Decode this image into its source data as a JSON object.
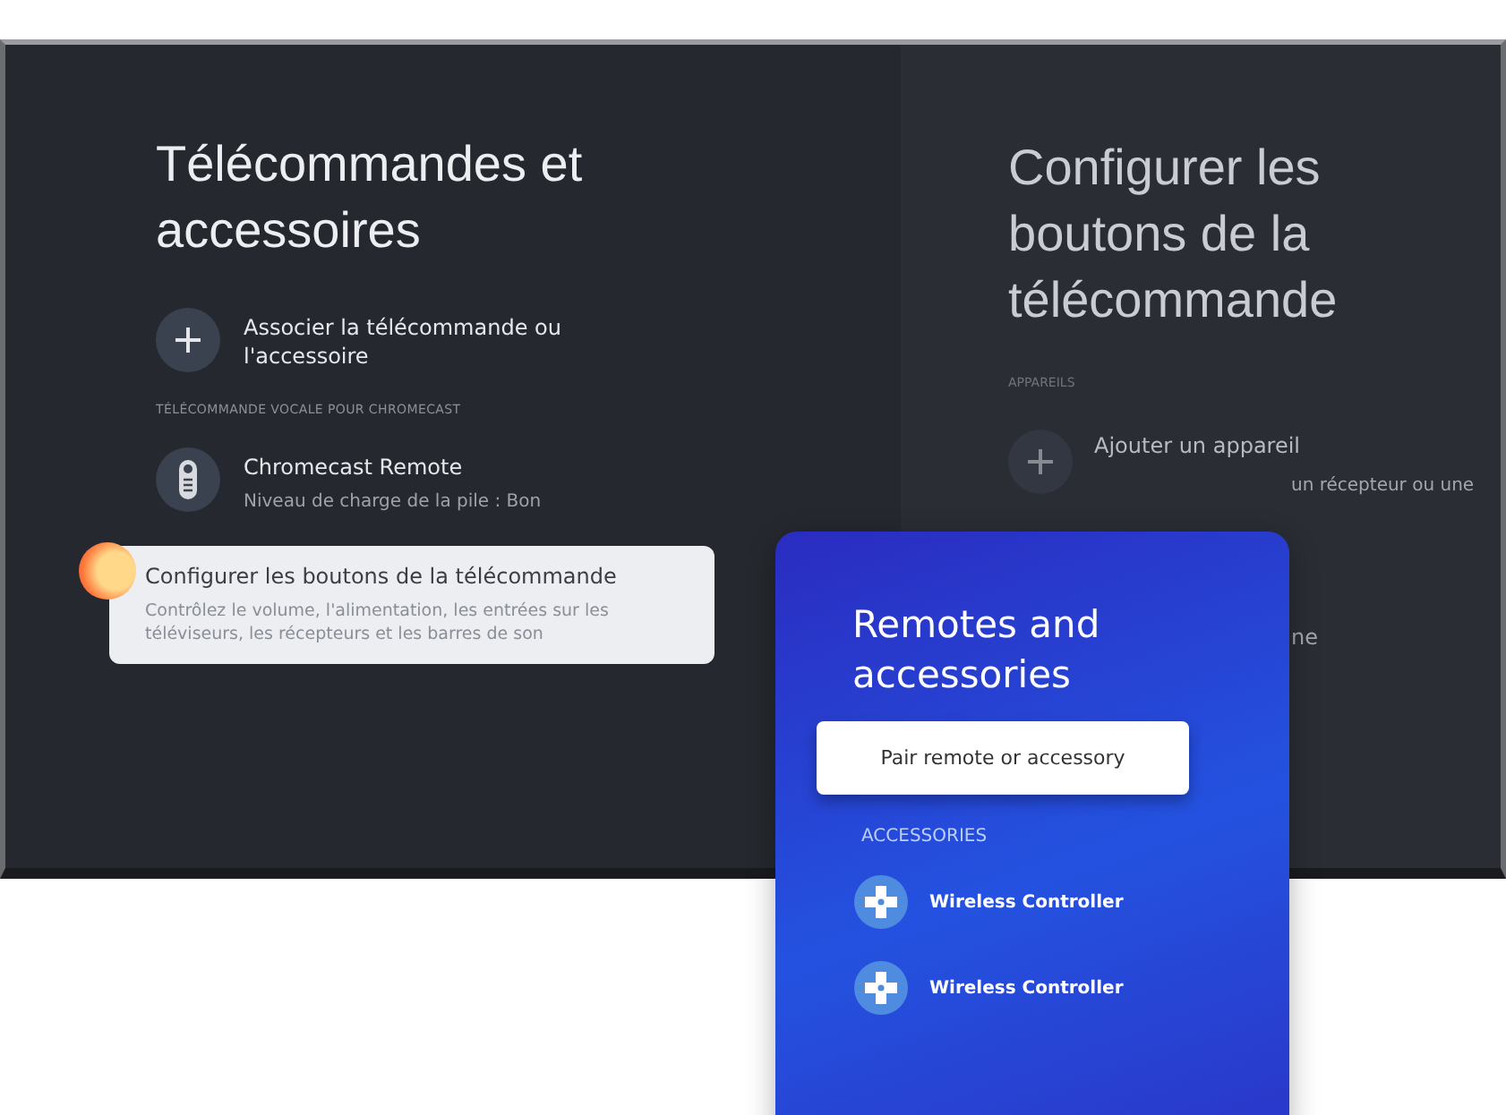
{
  "tv_screen": {
    "left_panel": {
      "title": "Télécommandes et accessoires",
      "items": [
        {
          "kind": "action",
          "title": "Associer la télécommande ou l'accessoire",
          "selected": false
        },
        {
          "kind": "header",
          "title": "TÉLÉCOMMANDE VOCALE POUR CHROMECAST"
        },
        {
          "kind": "device",
          "title": "Chromecast Remote",
          "subtitle": "Niveau de charge de la pile : Bon",
          "selected": false
        },
        {
          "kind": "option",
          "title": "Configurer les boutons de la télécommande",
          "subtitle": "Contrôlez le volume, l'alimentation, les entrées sur les téléviseurs, les récepteurs et les barres de son",
          "selected": true
        }
      ]
    },
    "right_panel": {
      "title": "Configurer les boutons de la télécommande",
      "section": "APPAREILS",
      "item_title": "Ajouter un appareil",
      "item_subtitle_fragment": "un récepteur ou une",
      "item_fragment": "ne"
    }
  },
  "overlay_card": {
    "title": "Remotes and accessories",
    "button": "Pair remote or accessory",
    "section": "ACCESSORIES",
    "accessories": [
      {
        "name": "Wireless Controller"
      },
      {
        "name": "Wireless Controller"
      }
    ]
  }
}
